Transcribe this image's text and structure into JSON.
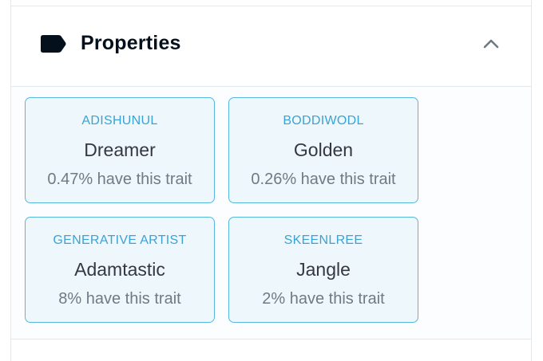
{
  "properties_section": {
    "title": "Properties",
    "icon": "label-tag-icon",
    "toggle_icon": "chevron-up-icon",
    "traits": [
      {
        "type": "ADISHUNUL",
        "value": "Dreamer",
        "rarity": "0.47% have this trait"
      },
      {
        "type": "BODDIWODL",
        "value": "Golden",
        "rarity": "0.26% have this trait"
      },
      {
        "type": "GENERATIVE ARTIST",
        "value": "Adamtastic",
        "rarity": "8% have this trait"
      },
      {
        "type": "SKEENLREE",
        "value": "Jangle",
        "rarity": "2% have this trait"
      }
    ]
  }
}
